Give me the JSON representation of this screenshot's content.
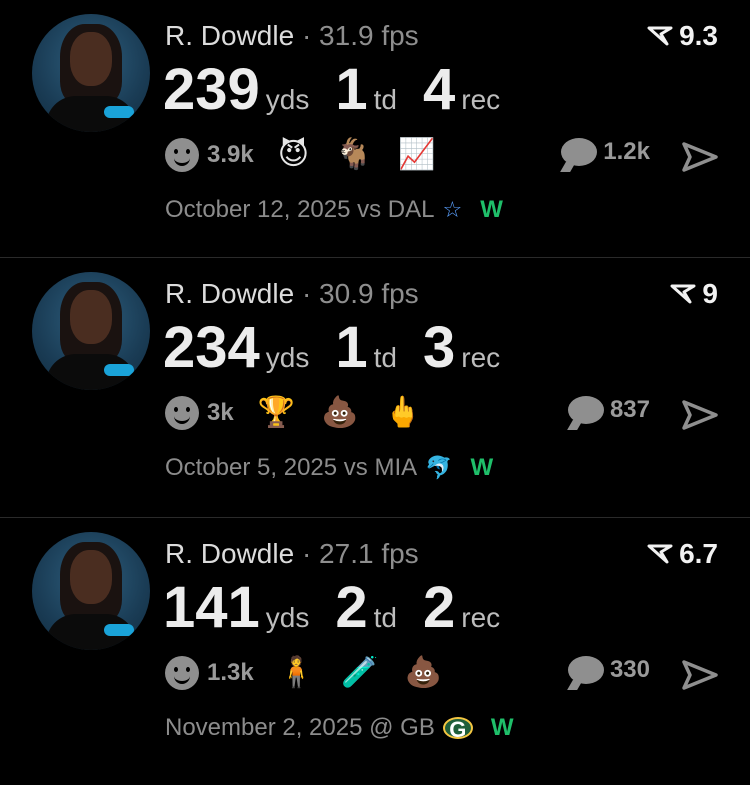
{
  "cards": [
    {
      "name": "R. Dowdle",
      "fps": "· 31.9 fps",
      "rating": "9.3",
      "yds": "239",
      "yds_label": "yds",
      "td": "1",
      "td_label": "td",
      "rec": "4",
      "rec_label": "rec",
      "likes": "3.9k",
      "emojis": [
        "😈",
        "🐐",
        "📈"
      ],
      "comments": "1.2k",
      "date": "October 12, 2025 vs DAL",
      "team_icon": "☆",
      "result": "W"
    },
    {
      "name": "R. Dowdle",
      "fps": "· 30.9 fps",
      "rating": "9",
      "yds": "234",
      "yds_label": "yds",
      "td": "1",
      "td_label": "td",
      "rec": "3",
      "rec_label": "rec",
      "likes": "3k",
      "emojis": [
        "🏆",
        "💩",
        "🖕"
      ],
      "comments": "837",
      "date": "October 5, 2025 vs MIA",
      "team_icon": "🐬",
      "result": "W"
    },
    {
      "name": "R. Dowdle",
      "fps": "· 27.1 fps",
      "rating": "6.7",
      "yds": "141",
      "yds_label": "yds",
      "td": "2",
      "td_label": "td",
      "rec": "2",
      "rec_label": "rec",
      "likes": "1.3k",
      "emojis": [
        "🧍",
        "🧪",
        "💩"
      ],
      "comments": "330",
      "date": "November 2, 2025 @ GB",
      "team_icon": "G",
      "result": "W"
    }
  ],
  "colors": {
    "background": "#000000",
    "win": "#1fbf6a",
    "muted": "#8c8c8c"
  }
}
